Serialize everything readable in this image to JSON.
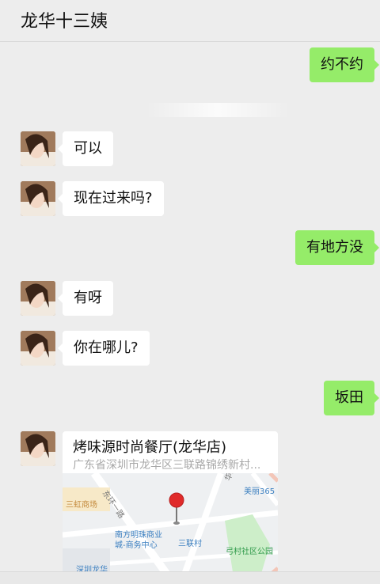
{
  "header": {
    "title": "龙华十三姨"
  },
  "messages": [
    {
      "text": "约不约"
    },
    {
      "text": "可以"
    },
    {
      "text": "现在过来吗?"
    },
    {
      "text": "有地方没"
    },
    {
      "text": "有呀"
    },
    {
      "text": "你在哪儿?"
    },
    {
      "text": "坂田"
    }
  ],
  "location": {
    "name": "烤味源时尚餐厅(龙华店)",
    "address": "广东省深圳市龙华区三联路锦绣新村...",
    "map_labels": {
      "shop": "三虹商场",
      "road": "东环一路",
      "road2": "华路",
      "beauty": "美丽365",
      "nanfang": "南方明珠商业城-商务中心",
      "sanlian": "三联村",
      "park": "弓村社区公园",
      "shenzhen": "深圳龙华"
    }
  },
  "colors": {
    "outgoing_bubble": "#95ec69",
    "incoming_bubble": "#ffffff",
    "background": "#ededed",
    "pin": "#e02a2a"
  },
  "icons": {
    "avatar": "user-avatar-photo",
    "pin": "map-pin-icon"
  }
}
